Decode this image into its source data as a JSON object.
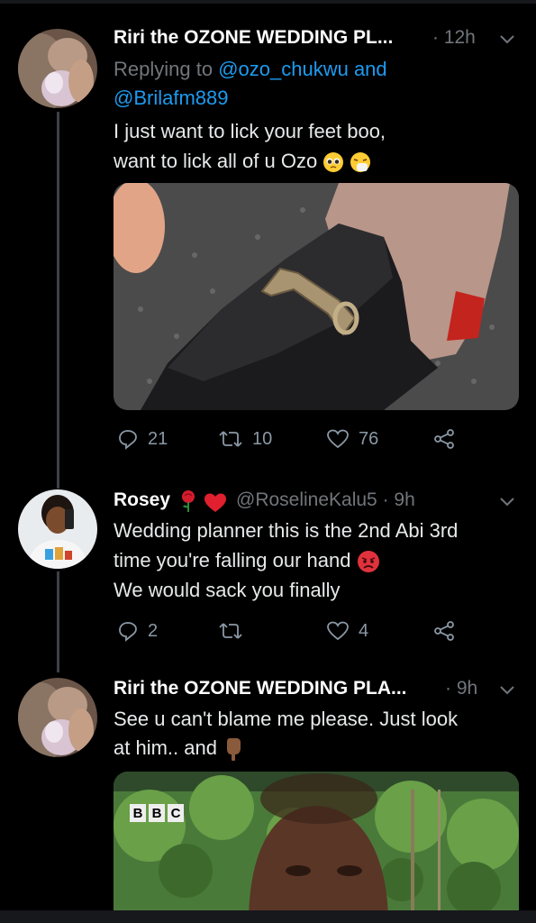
{
  "tweets": [
    {
      "name": "Riri the OZONE WEDDING PL...",
      "time": "· 12h",
      "reply_prefix": "Replying to ",
      "reply_user1": "@ozo_chukwu",
      "reply_and": " and",
      "reply_user2": "@Brilafm889",
      "line1": "I just want to lick your feet boo,",
      "line2": "want to lick all of u Ozo",
      "replies": "21",
      "retweets": "10",
      "likes": "76"
    },
    {
      "name": "Rosey",
      "handle_time": "@RoselineKalu5 · 9h",
      "line1": "Wedding planner this is the 2nd Abi 3rd",
      "line2": "time you're falling our hand",
      "line3": "We would sack you finally",
      "replies": "2",
      "retweets": "",
      "likes": "4"
    },
    {
      "name": "Riri the OZONE WEDDING PLA...",
      "time": "· 9h",
      "line1": "See u can't blame me please. Just look",
      "line2": "at him.. and",
      "media_logo": "BBC"
    }
  ],
  "colors": {
    "background": "#000000",
    "accent": "#1d9bf0",
    "muted": "#71767b",
    "thread_line": "#3d4146"
  },
  "icons": [
    "reply-icon",
    "retweet-icon",
    "like-icon",
    "share-icon",
    "chevron-down-icon"
  ]
}
